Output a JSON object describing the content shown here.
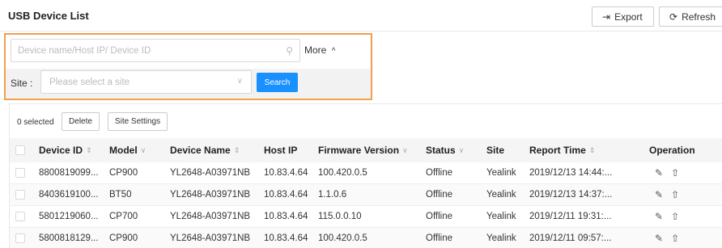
{
  "header": {
    "title": "USB Device List",
    "export_label": "Export",
    "refresh_label": "Refresh"
  },
  "filter": {
    "search_placeholder": "Device name/Host IP/ Device ID",
    "more_label": "More",
    "more_chevron": "^",
    "site_label": "Site :",
    "site_placeholder": "Please select a site",
    "search_button": "Search"
  },
  "toolbar": {
    "selected_count": "0 selected",
    "delete_label": "Delete",
    "site_settings_label": "Site Settings"
  },
  "table": {
    "columns": [
      {
        "label": "Device ID",
        "sort": "⇕"
      },
      {
        "label": "Model",
        "sort": "∨"
      },
      {
        "label": "Device Name",
        "sort": "⇕"
      },
      {
        "label": "Host IP",
        "sort": ""
      },
      {
        "label": "Firmware Version",
        "sort": "∨"
      },
      {
        "label": "Status",
        "sort": "∨"
      },
      {
        "label": "Site",
        "sort": ""
      },
      {
        "label": "Report Time",
        "sort": "⇕"
      },
      {
        "label": "Operation",
        "sort": ""
      }
    ],
    "rows": [
      {
        "device_id": "8800819099...",
        "model": "CP900",
        "device_name": "YL2648-A03971NB",
        "host_ip": "10.83.4.64",
        "firmware": "100.420.0.5",
        "status": "Offline",
        "site": "Yealink",
        "report_time": "2019/12/13 14:44:..."
      },
      {
        "device_id": "8403619100...",
        "model": "BT50",
        "device_name": "YL2648-A03971NB",
        "host_ip": "10.83.4.64",
        "firmware": "1.1.0.6",
        "status": "Offline",
        "site": "Yealink",
        "report_time": "2019/12/13 14:37:..."
      },
      {
        "device_id": "5801219060...",
        "model": "CP700",
        "device_name": "YL2648-A03971NB",
        "host_ip": "10.83.4.64",
        "firmware": "115.0.0.10",
        "status": "Offline",
        "site": "Yealink",
        "report_time": "2019/12/11 19:31:..."
      },
      {
        "device_id": "5800818129...",
        "model": "CP900",
        "device_name": "YL2648-A03971NB",
        "host_ip": "10.83.4.64",
        "firmware": "100.420.0.5",
        "status": "Offline",
        "site": "Yealink",
        "report_time": "2019/12/11 09:57:..."
      }
    ],
    "operation_icons": [
      "edit-icon",
      "upload-icon"
    ]
  },
  "colors": {
    "highlight_border": "#f0a050",
    "primary": "#1890ff"
  }
}
